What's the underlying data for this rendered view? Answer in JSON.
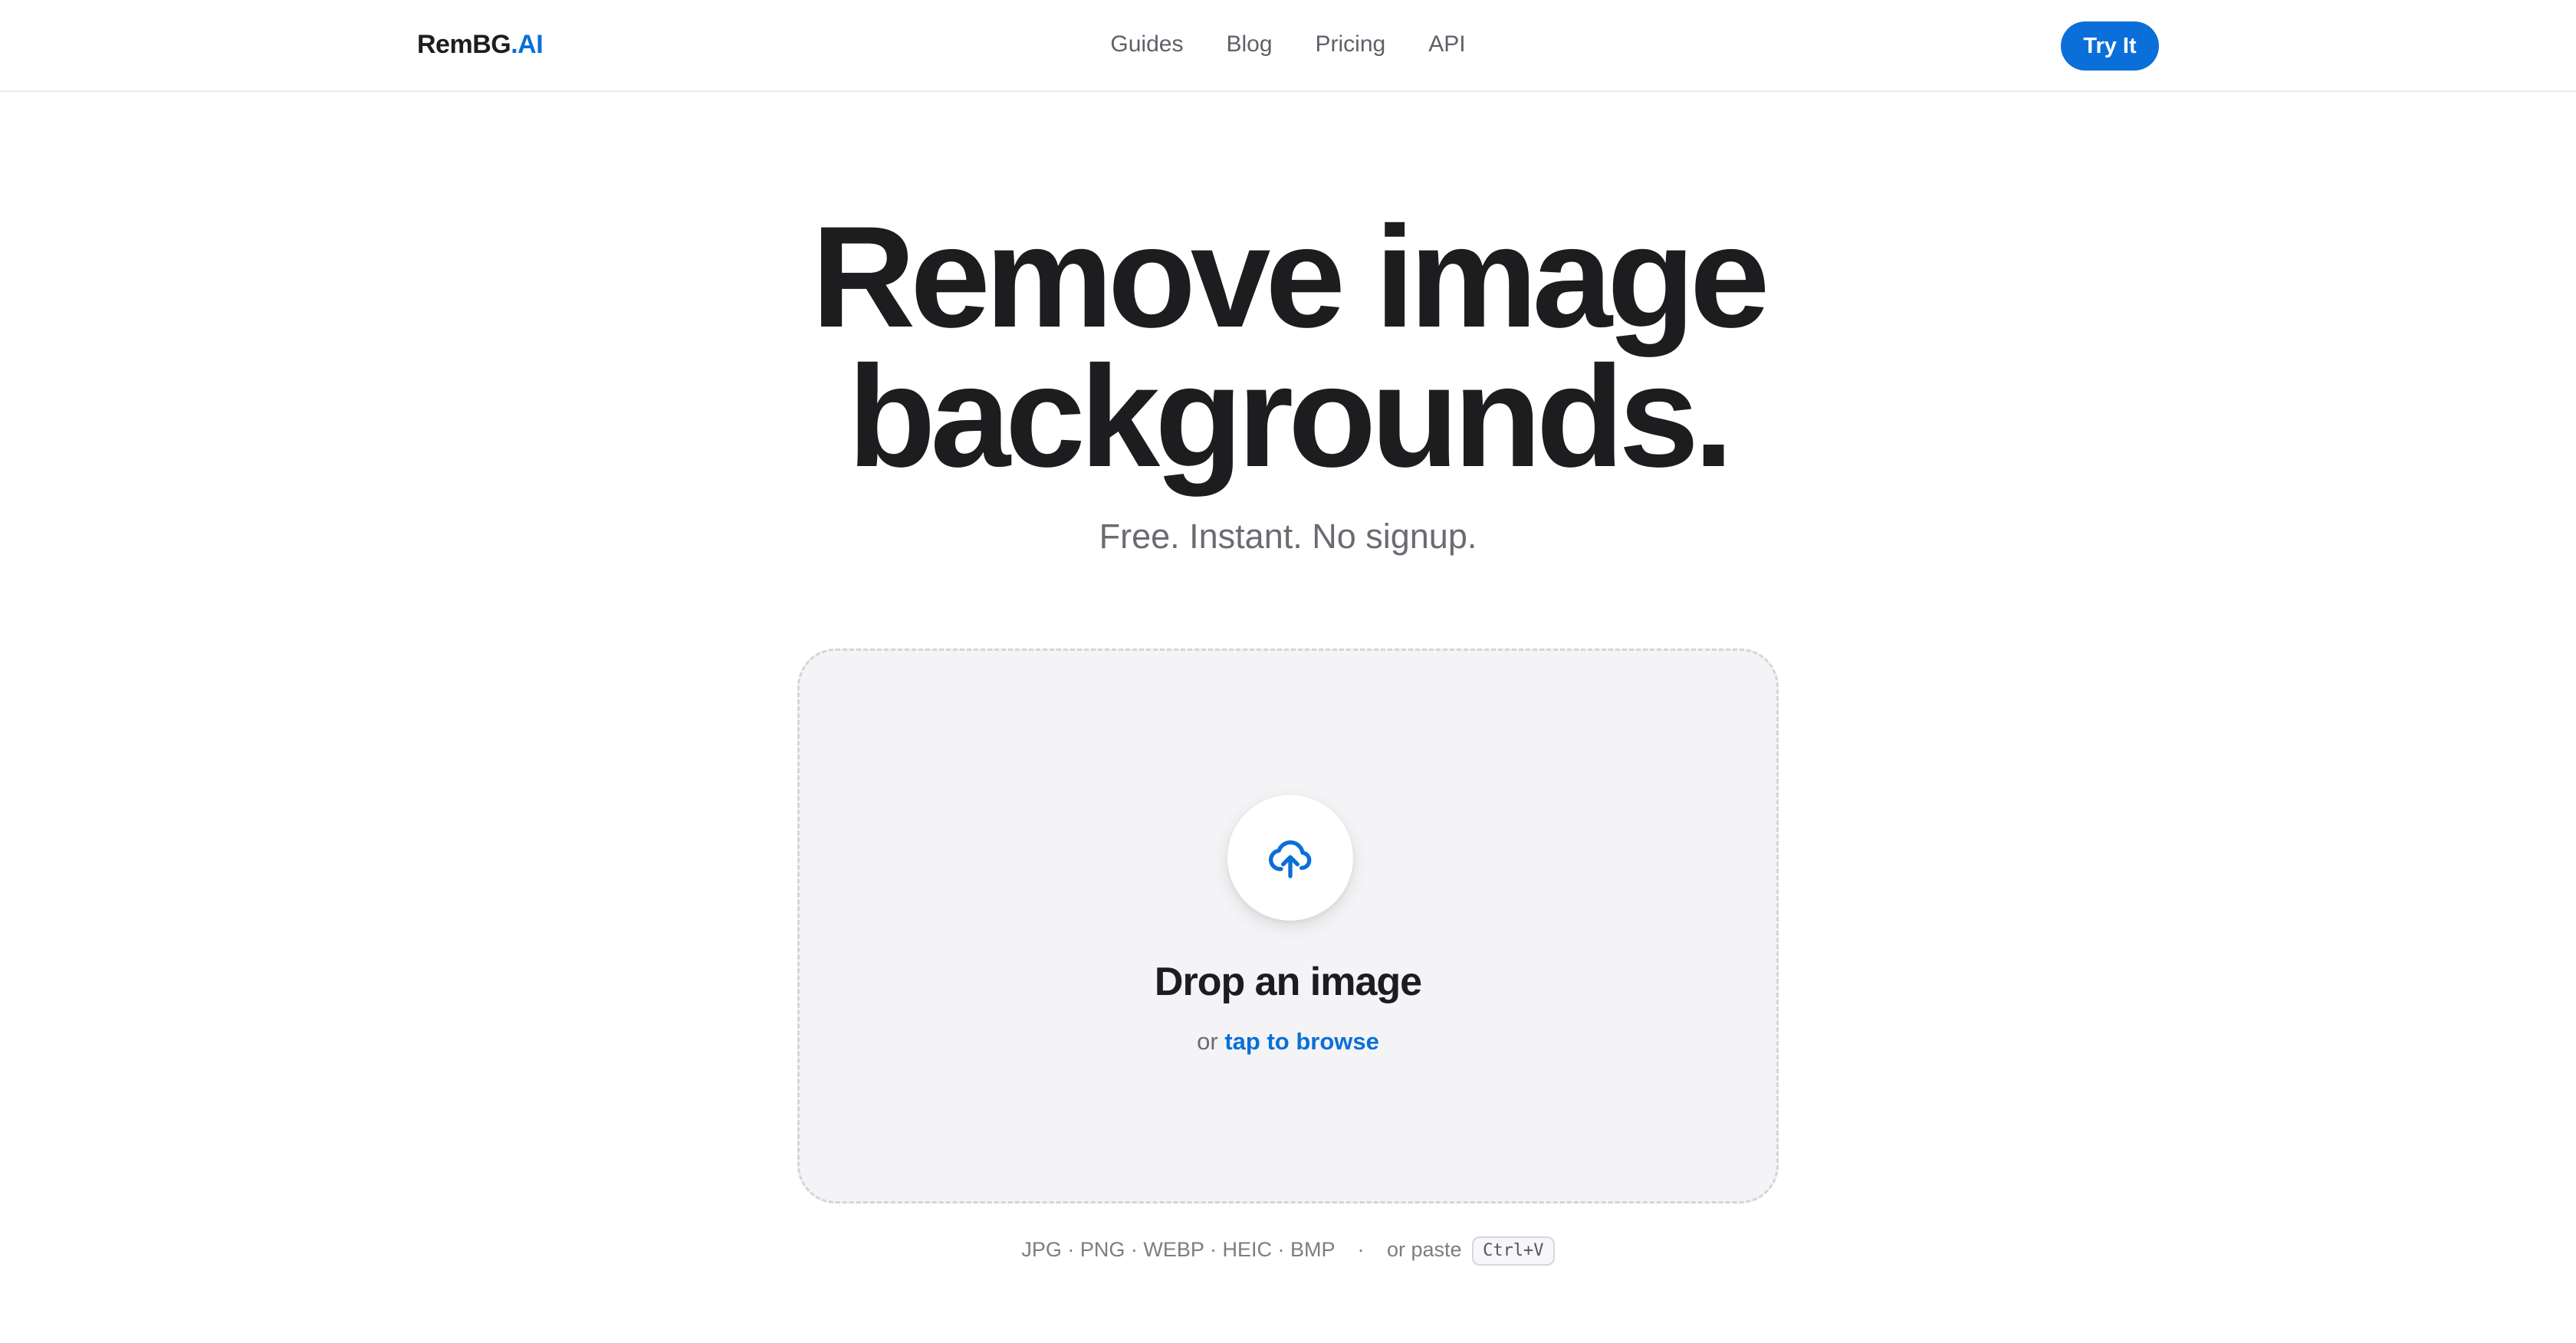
{
  "header": {
    "brand_main": "RemBG",
    "brand_accent": ".AI",
    "nav": [
      "Guides",
      "Blog",
      "Pricing",
      "API"
    ],
    "cta_label": "Try It"
  },
  "hero": {
    "title_line1": "Remove image",
    "title_line2": "backgrounds.",
    "subtitle": "Free. Instant. No signup."
  },
  "dropzone": {
    "icon": "cloud-upload-icon",
    "title": "Drop an image",
    "or_text": "or",
    "browse_text": "tap to browse"
  },
  "formats": {
    "list": "JPG · PNG · WEBP · HEIC · BMP",
    "separator": "·",
    "paste_text": "or paste",
    "shortcut": "Ctrl+V"
  },
  "colors": {
    "accent": "#0a6fd8",
    "text": "#1d1d1f",
    "muted": "#6a6c72",
    "dropzone_bg": "#f4f4f6"
  }
}
